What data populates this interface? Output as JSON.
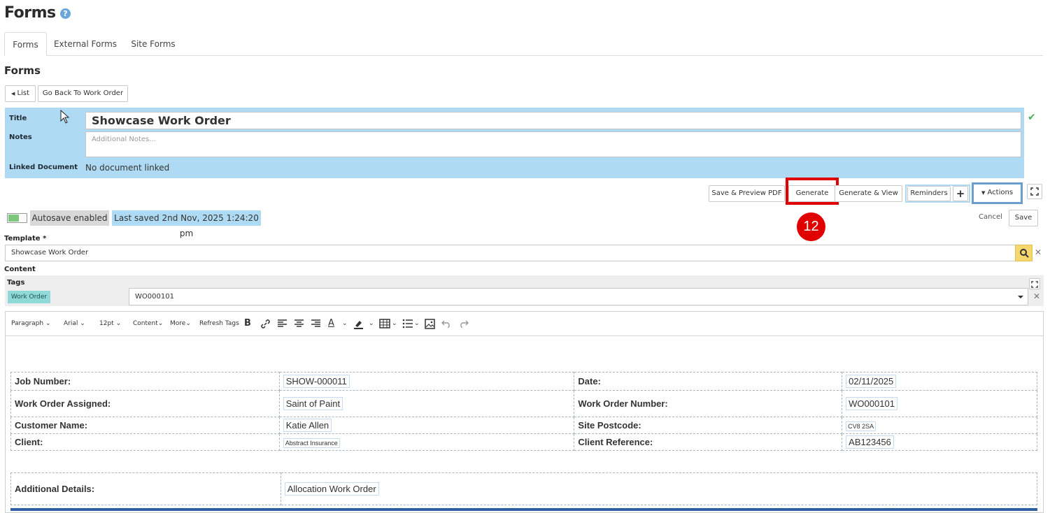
{
  "header": {
    "title": "Forms",
    "help_icon": "question-circle-icon"
  },
  "tabs": [
    {
      "label": "Forms",
      "active": true
    },
    {
      "label": "External Forms",
      "active": false
    },
    {
      "label": "Site Forms",
      "active": false
    }
  ],
  "section": {
    "title": "Forms"
  },
  "nav_buttons": {
    "list": "List",
    "back": "Go Back To Work Order"
  },
  "meta": {
    "title_label": "Title",
    "title_value": "Showcase Work Order",
    "notes_label": "Notes",
    "notes_placeholder": "Additional Notes...",
    "linked_label": "Linked Document",
    "linked_value": "No document linked"
  },
  "action_bar": {
    "save_preview": "Save & Preview PDF",
    "generate": "Generate",
    "generate_view": "Generate & View",
    "reminders": "Reminders",
    "add": "+",
    "actions": "Actions"
  },
  "annotation": {
    "step": "12",
    "color": "#e00000"
  },
  "status": {
    "autosave": "Autosave enabled",
    "last_saved": "Last saved 2nd Nov, 2025 1:24:20 pm",
    "toggle_on": true
  },
  "form_buttons": {
    "cancel": "Cancel",
    "save": "Save"
  },
  "template": {
    "label": "Template *",
    "value": "Showcase Work Order"
  },
  "content": {
    "label": "Content"
  },
  "tags": {
    "label": "Tags",
    "chip": "Work Order",
    "selected": "WO000101"
  },
  "toolbar": {
    "paragraph": "Paragraph",
    "font": "Arial",
    "size": "12pt",
    "content": "Content",
    "more": "More",
    "refresh_tags": "Refresh Tags"
  },
  "document": {
    "rows": [
      {
        "l1": "Job Number:",
        "v1": "SHOW-000011",
        "l2": "Date:",
        "v2": "02/11/2025"
      },
      {
        "l1": "Work Order Assigned:",
        "v1": "Saint of Paint",
        "l2": "Work Order Number:",
        "v2": "WO000101"
      },
      {
        "l1": "Customer Name:",
        "v1": "Katie Allen",
        "l2": "Site Postcode:",
        "v2": "CV8 2SA"
      },
      {
        "l1": "Client:",
        "v1": "Abstract Insurance",
        "l2": "Client Reference:",
        "v2": "AB123456"
      }
    ],
    "additional_label": "Additional Details:",
    "additional_value": "Allocation Work Order"
  },
  "colors": {
    "panel": "#afdaf3",
    "accent_blue": "#6a9ecd",
    "tag": "#8fdad8",
    "search": "#f5d76e"
  }
}
